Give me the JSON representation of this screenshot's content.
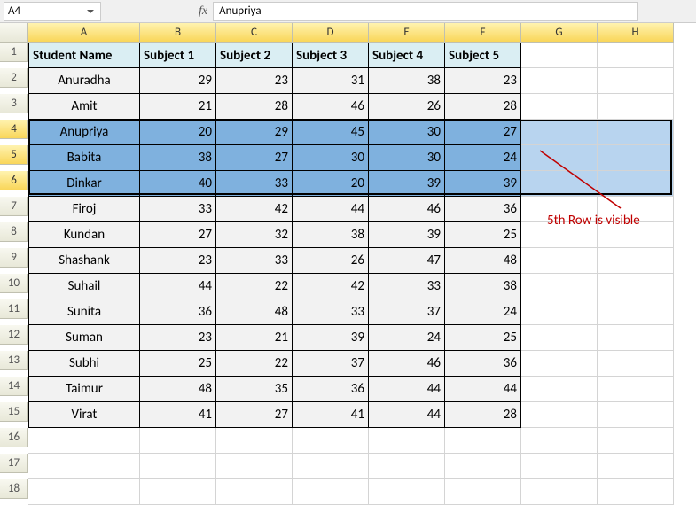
{
  "namebox": {
    "ref": "A4"
  },
  "formula": {
    "fx_label": "fx",
    "value": "Anupriya"
  },
  "columns": [
    "A",
    "B",
    "C",
    "D",
    "E",
    "F",
    "G",
    "H"
  ],
  "rows": [
    "1",
    "2",
    "3",
    "4",
    "5",
    "6",
    "7",
    "8",
    "9",
    "10",
    "11",
    "12",
    "13",
    "14",
    "15",
    "16",
    "17",
    "18"
  ],
  "headers": [
    "Student Name",
    "Subject 1",
    "Subject 2",
    "Subject 3",
    "Subject 4",
    "Subject 5"
  ],
  "data": [
    {
      "name": "Anuradha",
      "s1": "29",
      "s2": "23",
      "s3": "31",
      "s4": "38",
      "s5": "23"
    },
    {
      "name": "Amit",
      "s1": "21",
      "s2": "28",
      "s3": "46",
      "s4": "26",
      "s5": "28"
    },
    {
      "name": "Anupriya",
      "s1": "20",
      "s2": "29",
      "s3": "45",
      "s4": "30",
      "s5": "27"
    },
    {
      "name": "Babita",
      "s1": "38",
      "s2": "27",
      "s3": "30",
      "s4": "30",
      "s5": "24"
    },
    {
      "name": "Dinkar",
      "s1": "40",
      "s2": "33",
      "s3": "20",
      "s4": "39",
      "s5": "39"
    },
    {
      "name": "Firoj",
      "s1": "33",
      "s2": "42",
      "s3": "44",
      "s4": "46",
      "s5": "36"
    },
    {
      "name": "Kundan",
      "s1": "27",
      "s2": "32",
      "s3": "38",
      "s4": "39",
      "s5": "25"
    },
    {
      "name": "Shashank",
      "s1": "23",
      "s2": "33",
      "s3": "26",
      "s4": "47",
      "s5": "48"
    },
    {
      "name": "Suhail",
      "s1": "44",
      "s2": "22",
      "s3": "42",
      "s4": "33",
      "s5": "38"
    },
    {
      "name": "Sunita",
      "s1": "36",
      "s2": "48",
      "s3": "33",
      "s4": "37",
      "s5": "24"
    },
    {
      "name": "Suman",
      "s1": "23",
      "s2": "21",
      "s3": "39",
      "s4": "24",
      "s5": "25"
    },
    {
      "name": "Subhi",
      "s1": "25",
      "s2": "22",
      "s3": "37",
      "s4": "46",
      "s5": "36"
    },
    {
      "name": "Taimur",
      "s1": "48",
      "s2": "35",
      "s3": "36",
      "s4": "44",
      "s5": "44"
    },
    {
      "name": "Virat",
      "s1": "41",
      "s2": "27",
      "s3": "41",
      "s4": "44",
      "s5": "28"
    }
  ],
  "selected_rows": [
    4,
    5,
    6
  ],
  "annotation": {
    "text": "5th Row is visible"
  }
}
